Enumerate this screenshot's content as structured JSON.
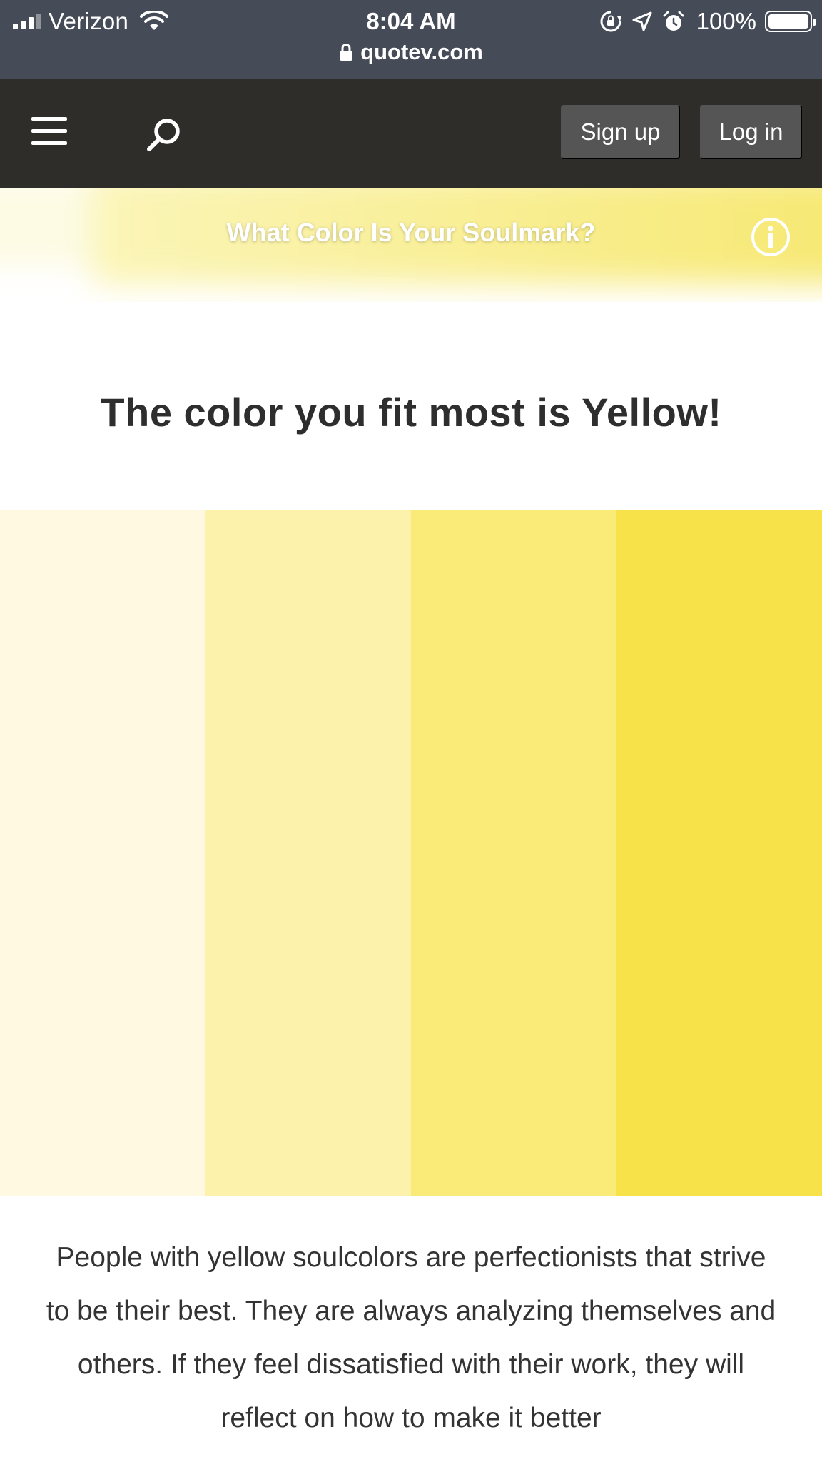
{
  "status_bar": {
    "carrier": "Verizon",
    "time": "8:04 AM",
    "battery": "100%",
    "battery_level": 1.0,
    "url": "quotev.com"
  },
  "navbar": {
    "signup_label": "Sign up",
    "login_label": "Log in"
  },
  "quiz": {
    "title": "What Color Is Your Soulmark?"
  },
  "result": {
    "heading": "The color you fit most is Yellow!",
    "swatch_colors": [
      "#fef9e0",
      "#fcf2ac",
      "#faea77",
      "#f8e24a"
    ],
    "description": "People with yellow soulcolors are perfectionists that strive to be their best. They are always analyzing themselves and others. If they feel dissatisfied with their work, they will reflect on how to make it better"
  },
  "colors": {
    "status_bar_bg": "#454c58",
    "navbar_bg": "#2e2d2a",
    "button_bg": "#555555"
  }
}
